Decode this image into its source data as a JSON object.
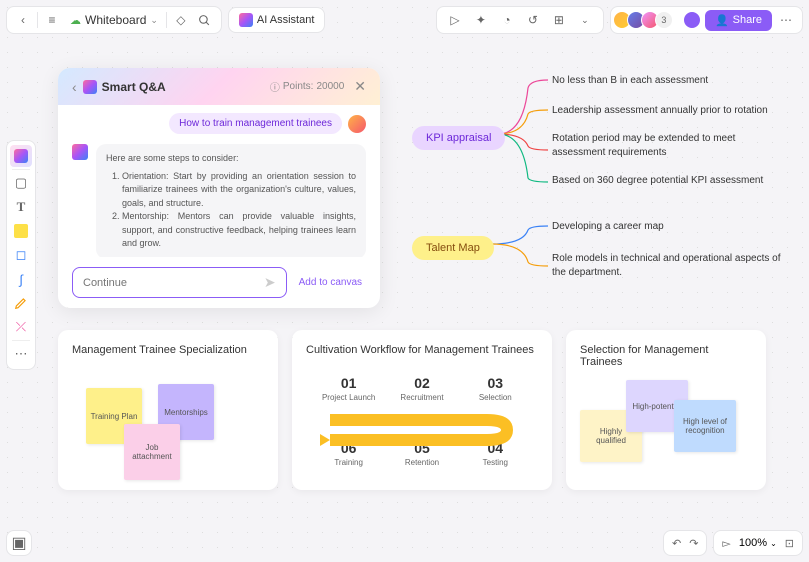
{
  "header": {
    "workspace_name": "Whiteboard",
    "ai_assistant_label": "AI Assistant",
    "share_label": "Share",
    "avatar_overflow": "3"
  },
  "qa": {
    "title": "Smart Q&A",
    "points_label": "Points:",
    "points_value": "20000",
    "user_msg": "How to train management trainees",
    "ai_intro": "Here are some steps to consider:",
    "ai_step1": "Orientation: Start by providing an orientation session to familiarize trainees with the organization's culture, values, goals, and structure.",
    "ai_step2": "Mentorship: Mentors can provide valuable insights, support, and constructive feedback, helping trainees learn and grow.",
    "input_placeholder": "Continue",
    "add_canvas": "Add to canvas"
  },
  "mindmap": {
    "kpi_label": "KPI appraisal",
    "kpi_leaf1": "No less than B in each assessment",
    "kpi_leaf2": "Leadership assessment annually prior to rotation",
    "kpi_leaf3": "Rotation period may be extended to meet assessment requirements",
    "kpi_leaf4": "Based on 360 degree potential KPI assessment",
    "talent_label": "Talent Map",
    "talent_leaf1": "Developing a career map",
    "talent_leaf2": "Role models in technical and operational aspects of the department."
  },
  "card1": {
    "title": "Management Trainee Specialization",
    "sticky1": "Training Plan",
    "sticky2": "Mentorships",
    "sticky3": "Job attachment"
  },
  "card2": {
    "title": "Cultivation Workflow for Management Trainees",
    "steps": {
      "s1n": "01",
      "s1l": "Project Launch",
      "s2n": "02",
      "s2l": "Recruitment",
      "s3n": "03",
      "s3l": "Selection",
      "s4n": "04",
      "s4l": "Testing",
      "s5n": "05",
      "s5l": "Retention",
      "s6n": "06",
      "s6l": "Training"
    }
  },
  "card3": {
    "title": "Selection for Management Trainees",
    "sticky1": "Highly qualified",
    "sticky2": "High-potential",
    "sticky3": "High level of recognition"
  },
  "bottom": {
    "zoom": "100%"
  }
}
